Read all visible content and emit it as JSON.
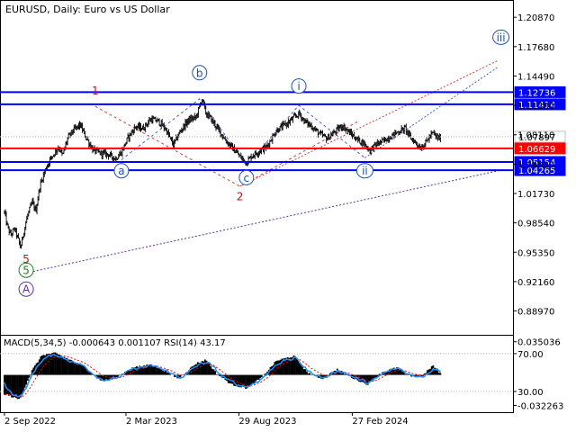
{
  "chart_data": {
    "type": "line",
    "title": "EURUSD, Daily:  Euro vs US Dollar",
    "ylim": [
      0.8658,
      1.2255
    ],
    "y_ticks": [
      "1.20870",
      "1.17680",
      "1.14490",
      "1.11300",
      "1.08110",
      "1.04920",
      "1.01730",
      "0.98540",
      "0.95350",
      "0.92160",
      "0.88970"
    ],
    "x_ticks": [
      {
        "label": "2 Sep 2022",
        "t": 0.0
      },
      {
        "label": "2 Mar 2023",
        "t": 0.241
      },
      {
        "label": "29 Aug 2023",
        "t": 0.465
      },
      {
        "label": "27 Feb 2024",
        "t": 0.69
      }
    ],
    "x_range_dates": [
      "2022-09-02",
      "2024-07-31"
    ],
    "price_key_points": [
      [
        0.0,
        0.997
      ],
      [
        0.005,
        0.983
      ],
      [
        0.012,
        0.972
      ],
      [
        0.02,
        0.979
      ],
      [
        0.028,
        0.966
      ],
      [
        0.032,
        0.958
      ],
      [
        0.038,
        0.975
      ],
      [
        0.045,
        0.992
      ],
      [
        0.055,
        1.008
      ],
      [
        0.062,
        0.998
      ],
      [
        0.07,
        1.025
      ],
      [
        0.08,
        1.042
      ],
      [
        0.09,
        1.054
      ],
      [
        0.1,
        1.062
      ],
      [
        0.108,
        1.068
      ],
      [
        0.115,
        1.058
      ],
      [
        0.125,
        1.077
      ],
      [
        0.135,
        1.085
      ],
      [
        0.15,
        1.092
      ],
      [
        0.162,
        1.078
      ],
      [
        0.175,
        1.065
      ],
      [
        0.19,
        1.061
      ],
      [
        0.205,
        1.06
      ],
      [
        0.22,
        1.055
      ],
      [
        0.232,
        1.062
      ],
      [
        0.245,
        1.078
      ],
      [
        0.26,
        1.09
      ],
      [
        0.275,
        1.088
      ],
      [
        0.29,
        1.098
      ],
      [
        0.305,
        1.096
      ],
      [
        0.32,
        1.087
      ],
      [
        0.335,
        1.07
      ],
      [
        0.35,
        1.086
      ],
      [
        0.365,
        1.097
      ],
      [
        0.38,
        1.1
      ],
      [
        0.392,
        1.12
      ],
      [
        0.4,
        1.104
      ],
      [
        0.41,
        1.098
      ],
      [
        0.425,
        1.086
      ],
      [
        0.44,
        1.074
      ],
      [
        0.455,
        1.065
      ],
      [
        0.47,
        1.056
      ],
      [
        0.48,
        1.051
      ],
      [
        0.49,
        1.058
      ],
      [
        0.505,
        1.063
      ],
      [
        0.52,
        1.068
      ],
      [
        0.54,
        1.086
      ],
      [
        0.56,
        1.093
      ],
      [
        0.575,
        1.1
      ],
      [
        0.585,
        1.104
      ],
      [
        0.595,
        1.096
      ],
      [
        0.61,
        1.09
      ],
      [
        0.625,
        1.082
      ],
      [
        0.64,
        1.077
      ],
      [
        0.655,
        1.084
      ],
      [
        0.67,
        1.091
      ],
      [
        0.685,
        1.083
      ],
      [
        0.7,
        1.076
      ],
      [
        0.712,
        1.072
      ],
      [
        0.725,
        1.064
      ],
      [
        0.735,
        1.07
      ],
      [
        0.75,
        1.074
      ],
      [
        0.765,
        1.079
      ],
      [
        0.78,
        1.084
      ],
      [
        0.795,
        1.088
      ],
      [
        0.805,
        1.078
      ],
      [
        0.815,
        1.073
      ],
      [
        0.825,
        1.067
      ],
      [
        0.835,
        1.072
      ],
      [
        0.845,
        1.08
      ],
      [
        0.85,
        1.083
      ],
      [
        0.858,
        1.078
      ],
      [
        0.865,
        1.077
      ]
    ],
    "price_labels": [
      {
        "text": "1.12736",
        "value": 1.12736,
        "color": "#0000ff",
        "text_color": "#ffffff"
      },
      {
        "text": "1.11414",
        "value": 1.11414,
        "color": "#0000ff",
        "text_color": "#ffffff"
      },
      {
        "text": "1.07897",
        "value": 1.07897,
        "color": "#ffffff",
        "text_color": "#000000",
        "border": "#c0c0c0"
      },
      {
        "text": "1.06629",
        "value": 1.06629,
        "color": "#ff0000",
        "text_color": "#ffffff"
      },
      {
        "text": "1.05154",
        "value": 1.05154,
        "color": "#0000ff",
        "text_color": "#ffffff"
      },
      {
        "text": "1.04265",
        "value": 1.04265,
        "color": "#0000ff",
        "text_color": "#ffffff"
      }
    ],
    "horizontal_levels": [
      {
        "value": 1.12736,
        "color": "#0000ff"
      },
      {
        "value": 1.11414,
        "color": "#0000ff"
      },
      {
        "value": 1.06629,
        "color": "#ff0000"
      },
      {
        "value": 1.05154,
        "color": "#0000ff"
      },
      {
        "value": 1.04265,
        "color": "#0000ff"
      }
    ],
    "current_price_level": 1.07897,
    "wave_labels": [
      {
        "text": "1",
        "t": 0.18,
        "y": 1.129,
        "color": "#b01818",
        "circled": false
      },
      {
        "text": "2",
        "t": 0.467,
        "y": 1.0145,
        "color": "#b01818",
        "circled": false
      },
      {
        "text": "5",
        "t": 0.043,
        "y": 0.9462,
        "color": "#b01818",
        "circled": false
      },
      {
        "text": "a",
        "t": 0.232,
        "y": 1.042,
        "color": "#1a4fc0",
        "circled": true
      },
      {
        "text": "b",
        "t": 0.387,
        "y": 1.1485,
        "color": "#1a4fc0",
        "circled": true
      },
      {
        "text": "c",
        "t": 0.48,
        "y": 1.0345,
        "color": "#1a4fc0",
        "circled": true
      },
      {
        "text": "i",
        "t": 0.584,
        "y": 1.134,
        "color": "#1a4fc0",
        "circled": true
      },
      {
        "text": "ii",
        "t": 0.715,
        "y": 1.042,
        "color": "#1a4fc0",
        "circled": true
      },
      {
        "text": "5",
        "t": 0.043,
        "y": 0.934,
        "color": "#208020",
        "circled": true
      },
      {
        "text": "A",
        "t": 0.043,
        "y": 0.9135,
        "color": "#6030a0",
        "circled": true
      },
      {
        "text": "iii",
        "t": 0.985,
        "y": 1.187,
        "color": "#1a4fc0",
        "circled": true
      }
    ],
    "wave_lines": [
      {
        "color": "#d04040",
        "dash": "3,3",
        "points": [
          [
            0.18,
            1.112
          ],
          [
            0.467,
            1.025
          ],
          [
            0.7,
            1.095
          ]
        ]
      },
      {
        "color": "#4060d0",
        "dash": "3,3",
        "points": [
          [
            0.232,
            1.054
          ],
          [
            0.387,
            1.12
          ],
          [
            0.48,
            1.048
          ],
          [
            0.584,
            1.113
          ],
          [
            0.715,
            1.056
          ]
        ]
      },
      {
        "color": "#d04040",
        "dash": "2,2",
        "points": [
          [
            0.467,
            1.025
          ],
          [
            0.98,
            1.162
          ]
        ]
      },
      {
        "color": "#4060d0",
        "dash": "2,2",
        "points": [
          [
            0.715,
            1.056
          ],
          [
            0.98,
            1.155
          ]
        ]
      },
      {
        "color": "#6030a0",
        "dash": "2,2",
        "points": [
          [
            0.043,
            0.931
          ],
          [
            0.98,
            1.042
          ]
        ]
      }
    ],
    "macd": {
      "title": "MACD(5,34,5) -0.000643 0.001107 RSI(14) 43.17",
      "ylim": [
        -0.0375,
        0.0405
      ],
      "y_ticks": [
        {
          "label": "0.035036",
          "value": 0.035036
        },
        {
          "label": "70.00",
          "value": 0.0225
        },
        {
          "label": "30.00",
          "value": -0.0175
        },
        {
          "label": "-0.032263",
          "value": -0.032263
        }
      ],
      "histogram_key_points": [
        [
          0.0,
          -0.02
        ],
        [
          0.03,
          -0.026
        ],
        [
          0.055,
          0.005
        ],
        [
          0.075,
          0.021
        ],
        [
          0.1,
          0.023
        ],
        [
          0.13,
          0.016
        ],
        [
          0.16,
          0.008
        ],
        [
          0.19,
          -0.006
        ],
        [
          0.22,
          -0.004
        ],
        [
          0.25,
          0.007
        ],
        [
          0.29,
          0.011
        ],
        [
          0.32,
          0.004
        ],
        [
          0.345,
          -0.004
        ],
        [
          0.38,
          0.012
        ],
        [
          0.4,
          0.016
        ],
        [
          0.42,
          0.002
        ],
        [
          0.45,
          -0.01
        ],
        [
          0.48,
          -0.014
        ],
        [
          0.51,
          -0.003
        ],
        [
          0.54,
          0.015
        ],
        [
          0.575,
          0.02
        ],
        [
          0.6,
          0.003
        ],
        [
          0.63,
          -0.004
        ],
        [
          0.66,
          0.006
        ],
        [
          0.69,
          -0.003
        ],
        [
          0.72,
          -0.01
        ],
        [
          0.75,
          0.003
        ],
        [
          0.78,
          0.008
        ],
        [
          0.8,
          -0.001
        ],
        [
          0.83,
          -0.001
        ],
        [
          0.85,
          0.01
        ],
        [
          0.865,
          0.001
        ]
      ],
      "rsi_color": "#1e90ff",
      "signal_color": "#ff0000"
    }
  }
}
